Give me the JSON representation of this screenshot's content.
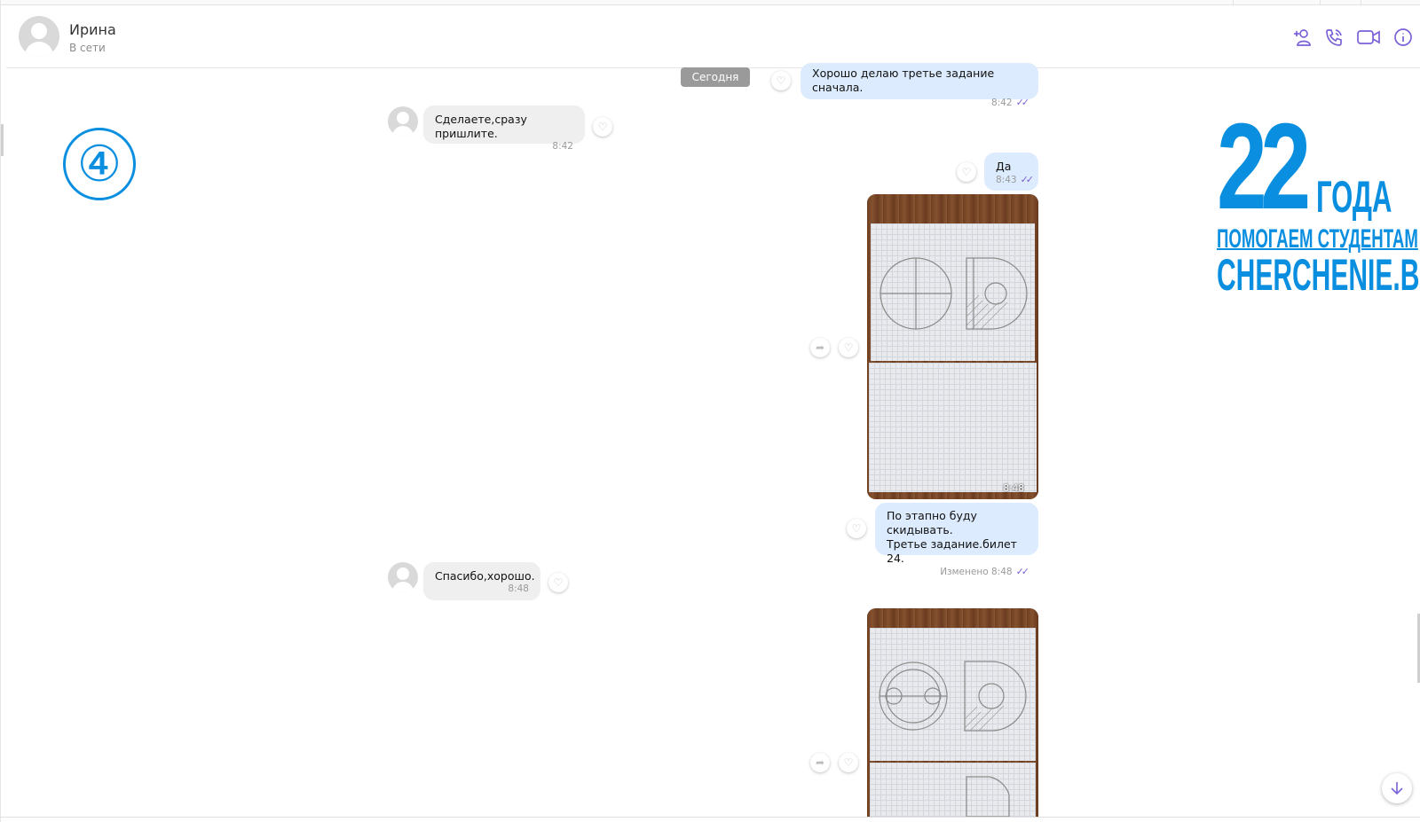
{
  "contact": {
    "name": "Ирина",
    "status": "В сети"
  },
  "header_icons": [
    "add-user-icon",
    "phone-icon",
    "video-camera-icon",
    "info-icon"
  ],
  "overlay": {
    "badge": "④",
    "brand_number": "22",
    "brand_word": "ГОДА",
    "brand_tagline": "ПОМОГАЕМ СТУДЕНТАМ",
    "brand_site": "CHERCHENIE.BY"
  },
  "colors": {
    "accent": "#7b61d6",
    "brand": "#0a8fe0",
    "out_bubble": "#dcebfd",
    "in_bubble": "#efefef"
  },
  "date_divider": "Сегодня",
  "messages": [
    {
      "direction": "out",
      "lines": [
        "Хорошо делаю третье задание сначала."
      ],
      "time": "8:42"
    },
    {
      "direction": "in",
      "lines": [
        "Сделаете,сразу пришлите."
      ],
      "time": "8:42"
    },
    {
      "direction": "out",
      "lines": [
        "Да"
      ],
      "time": "8:43"
    },
    {
      "direction": "out",
      "type": "photo",
      "time": "8:48"
    },
    {
      "direction": "out",
      "lines": [
        "По этапно буду скидывать.",
        "Третье задание.билет 24."
      ],
      "time": "Изменено 8:48"
    },
    {
      "direction": "in",
      "lines": [
        "Спасибо,хорошо."
      ],
      "time": "8:48"
    },
    {
      "direction": "out",
      "type": "photo",
      "time": ""
    }
  ],
  "icons": {
    "like": "heart-icon",
    "share": "share-icon",
    "scroll": "arrow-down-icon",
    "ticks": "✓✓"
  }
}
